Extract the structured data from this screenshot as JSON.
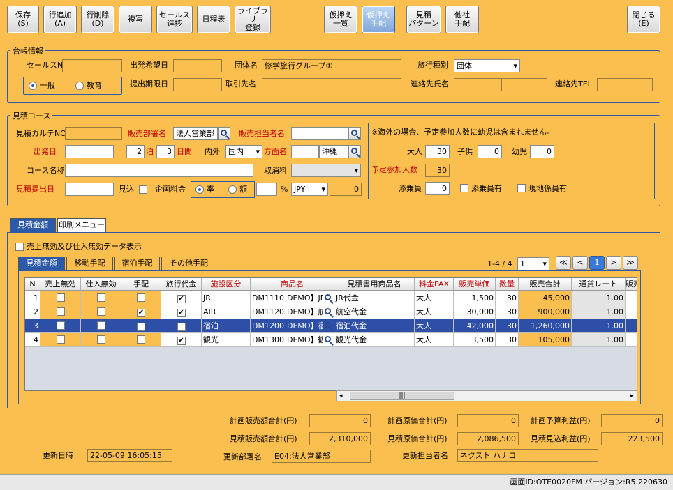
{
  "toolbar": {
    "save": "保存\n(S)",
    "add_row": "行追加\n(A)",
    "del_row": "行削除\n(D)",
    "copy": "複写",
    "sales_progress": "セールス\n進捗",
    "schedule": "日程表",
    "library": "ライブラリ\n登録",
    "temp_list": "仮押え\n一覧",
    "temp_arrange": "仮押え\n手配",
    "est_pattern": "見積\nパターン",
    "other_arrange": "他社\n手配",
    "close": "閉じる\n(E)"
  },
  "ledger": {
    "legend": "台帳情報",
    "sales_no_label": "セールスNO",
    "sales_no": "",
    "depart_wish_label": "出発希望日",
    "depart_wish": "",
    "group_label": "団体名",
    "group": "修学旅行グループ①",
    "trip_type_label": "旅行種別",
    "trip_type": "団体",
    "radio_general": "一般",
    "radio_edu": "教育",
    "submit_due_label": "提出期限日",
    "submit_due": "",
    "client_label": "取引先名",
    "client": "",
    "contact_label": "連絡先氏名",
    "contact1": "",
    "contact2": "",
    "tel_label": "連絡先TEL",
    "tel": ""
  },
  "course": {
    "legend": "見積コース",
    "karte_label": "見積カルテNO",
    "karte": "",
    "dept_label": "販売部署名",
    "dept": "法人営業部",
    "staff_label": "販売担当者名",
    "staff": "",
    "depart_label": "出発日",
    "depart": "",
    "nights": "2",
    "nights_label": "泊",
    "days": "3",
    "days_label": "日間",
    "inout_label": "内外",
    "inout": "国内",
    "area_label": "方面名",
    "area_code": "",
    "area": "沖縄",
    "course_name_label": "コース名称",
    "course_name": "",
    "cancel_label": "取消料",
    "cancel": "",
    "submit_label": "見積提出日",
    "submit": "",
    "prospect_label": "見込",
    "plan_fee_label": "企画料金",
    "rate": "率",
    "amount": "額",
    "fee_value": "",
    "percent": "%",
    "currency": "JPY",
    "fee_amount": "0",
    "note": "※海外の場合、予定参加人数に幼児は含まれません。",
    "adult_label": "大人",
    "adult": "30",
    "child_label": "子供",
    "child": "0",
    "infant_label": "幼児",
    "infant": "0",
    "planned_label": "予定参加人数",
    "planned": "30",
    "escort_label": "添乗員",
    "escort": "0",
    "escort_chk": "添乗員有",
    "local_chk": "現地係員有"
  },
  "tabs": {
    "estimate": "見積金額",
    "print": "印刷メニュー"
  },
  "invalid_chk": "売上無効及び仕入無効データ表示",
  "subtabs": [
    "見積金額",
    "移動手配",
    "宿泊手配",
    "その他手配"
  ],
  "paging": {
    "count": "1-4 / 4",
    "page": "1",
    "first": "≪",
    "prev": "<",
    "cur": "1",
    "next": ">",
    "last": "≫"
  },
  "grid": {
    "headers": [
      "N",
      "売上無効",
      "仕入無効",
      "手配",
      "旅行代金",
      "施設区分",
      "商品名",
      "見積書用商品名",
      "料金PAX",
      "販売単価",
      "数量",
      "販売合計",
      "通貨レート",
      "販売"
    ],
    "rows": [
      {
        "n": "1",
        "c1": false,
        "c2": false,
        "c3": false,
        "c4": true,
        "kubun": "JR",
        "code": "DM1110",
        "name": "DEMO】JR",
        "est": "JR代金",
        "pax": "大人",
        "price": "1,500",
        "qty": "30",
        "total": "45,000",
        "rate": "1.00"
      },
      {
        "n": "2",
        "c1": false,
        "c2": false,
        "c3": true,
        "c4": true,
        "kubun": "AIR",
        "code": "DM1120",
        "name": "DEMO】航",
        "est": "航空代金",
        "pax": "大人",
        "price": "30,000",
        "qty": "30",
        "total": "900,000",
        "rate": "1.00"
      },
      {
        "n": "3",
        "c1": false,
        "c2": false,
        "c3": true,
        "c4": true,
        "kubun": "宿泊",
        "code": "DM1200",
        "name": "DEMO】宿",
        "est": "宿泊代金",
        "pax": "大人",
        "price": "42,000",
        "qty": "30",
        "total": "1,260,000",
        "rate": "1.00"
      },
      {
        "n": "4",
        "c1": false,
        "c2": false,
        "c3": false,
        "c4": true,
        "kubun": "観光",
        "code": "DM1300",
        "name": "DEMO】観",
        "est": "観光代金",
        "pax": "大人",
        "price": "3,500",
        "qty": "30",
        "total": "105,000",
        "rate": "1.00"
      }
    ]
  },
  "totals": {
    "plan_sales_label": "計画販売額合計(円)",
    "plan_sales": "0",
    "plan_cost_label": "計画原価合計(円)",
    "plan_cost": "0",
    "plan_profit_label": "計画予算利益(円)",
    "plan_profit": "0",
    "est_sales_label": "見積販売額合計(円)",
    "est_sales": "2,310,000",
    "est_cost_label": "見積原価合計(円)",
    "est_cost": "2,086,500",
    "est_profit_label": "見積見込利益(円)",
    "est_profit": "223,500"
  },
  "footer": {
    "updated_label": "更新日時",
    "updated": "22-05-09 16:05:15",
    "upd_dept_label": "更新部署名",
    "upd_dept": "E04:法人営業部",
    "upd_staff_label": "更新担当者名",
    "upd_staff": "ネクスト ハナコ"
  },
  "status": "画面ID:OTE0020FM バージョン:R5.220630"
}
